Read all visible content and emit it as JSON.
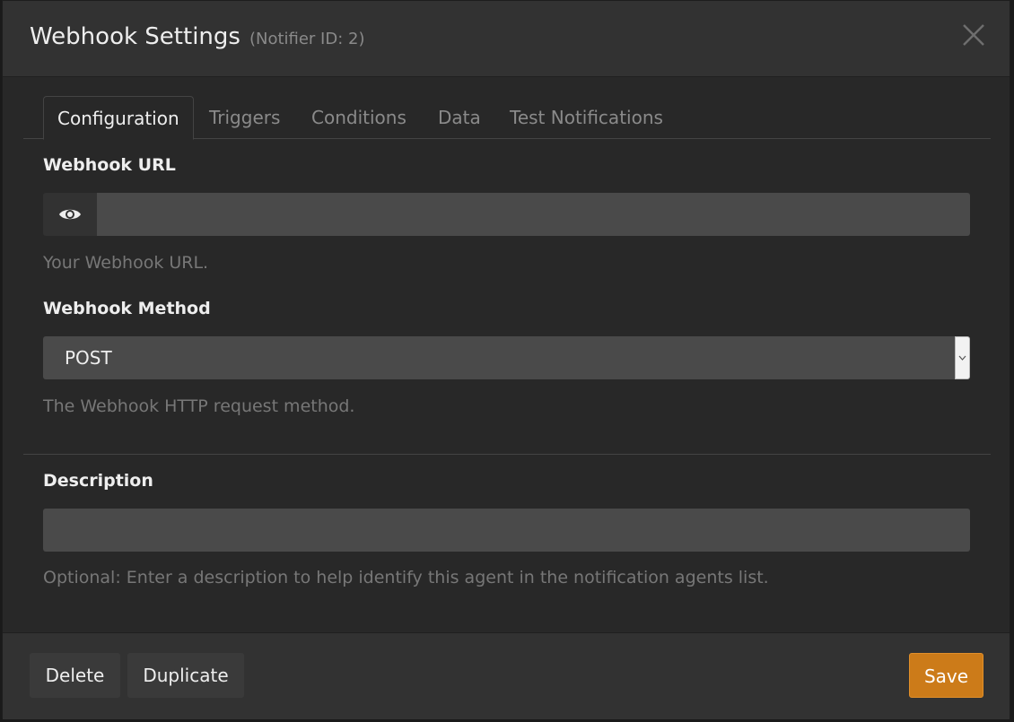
{
  "modal": {
    "title": "Webhook Settings",
    "subtitle": "(Notifier ID: 2)"
  },
  "tabs": [
    {
      "label": "Configuration",
      "active": true
    },
    {
      "label": "Triggers",
      "active": false
    },
    {
      "label": "Conditions",
      "active": false
    },
    {
      "label": "Data",
      "active": false
    },
    {
      "label": "Test Notifications",
      "active": false
    }
  ],
  "webhook_url": {
    "label": "Webhook URL",
    "value": "",
    "help": "Your Webhook URL.",
    "icon": "eye-icon"
  },
  "webhook_method": {
    "label": "Webhook Method",
    "selected": "POST",
    "help": "The Webhook HTTP request method."
  },
  "description": {
    "label": "Description",
    "value": "",
    "help": "Optional: Enter a description to help identify this agent in the notification agents list."
  },
  "footer": {
    "delete_label": "Delete",
    "duplicate_label": "Duplicate",
    "save_label": "Save"
  },
  "colors": {
    "accent": "#cc7b19",
    "background": "#282828",
    "header": "#323232",
    "input": "#4a4a4a"
  }
}
